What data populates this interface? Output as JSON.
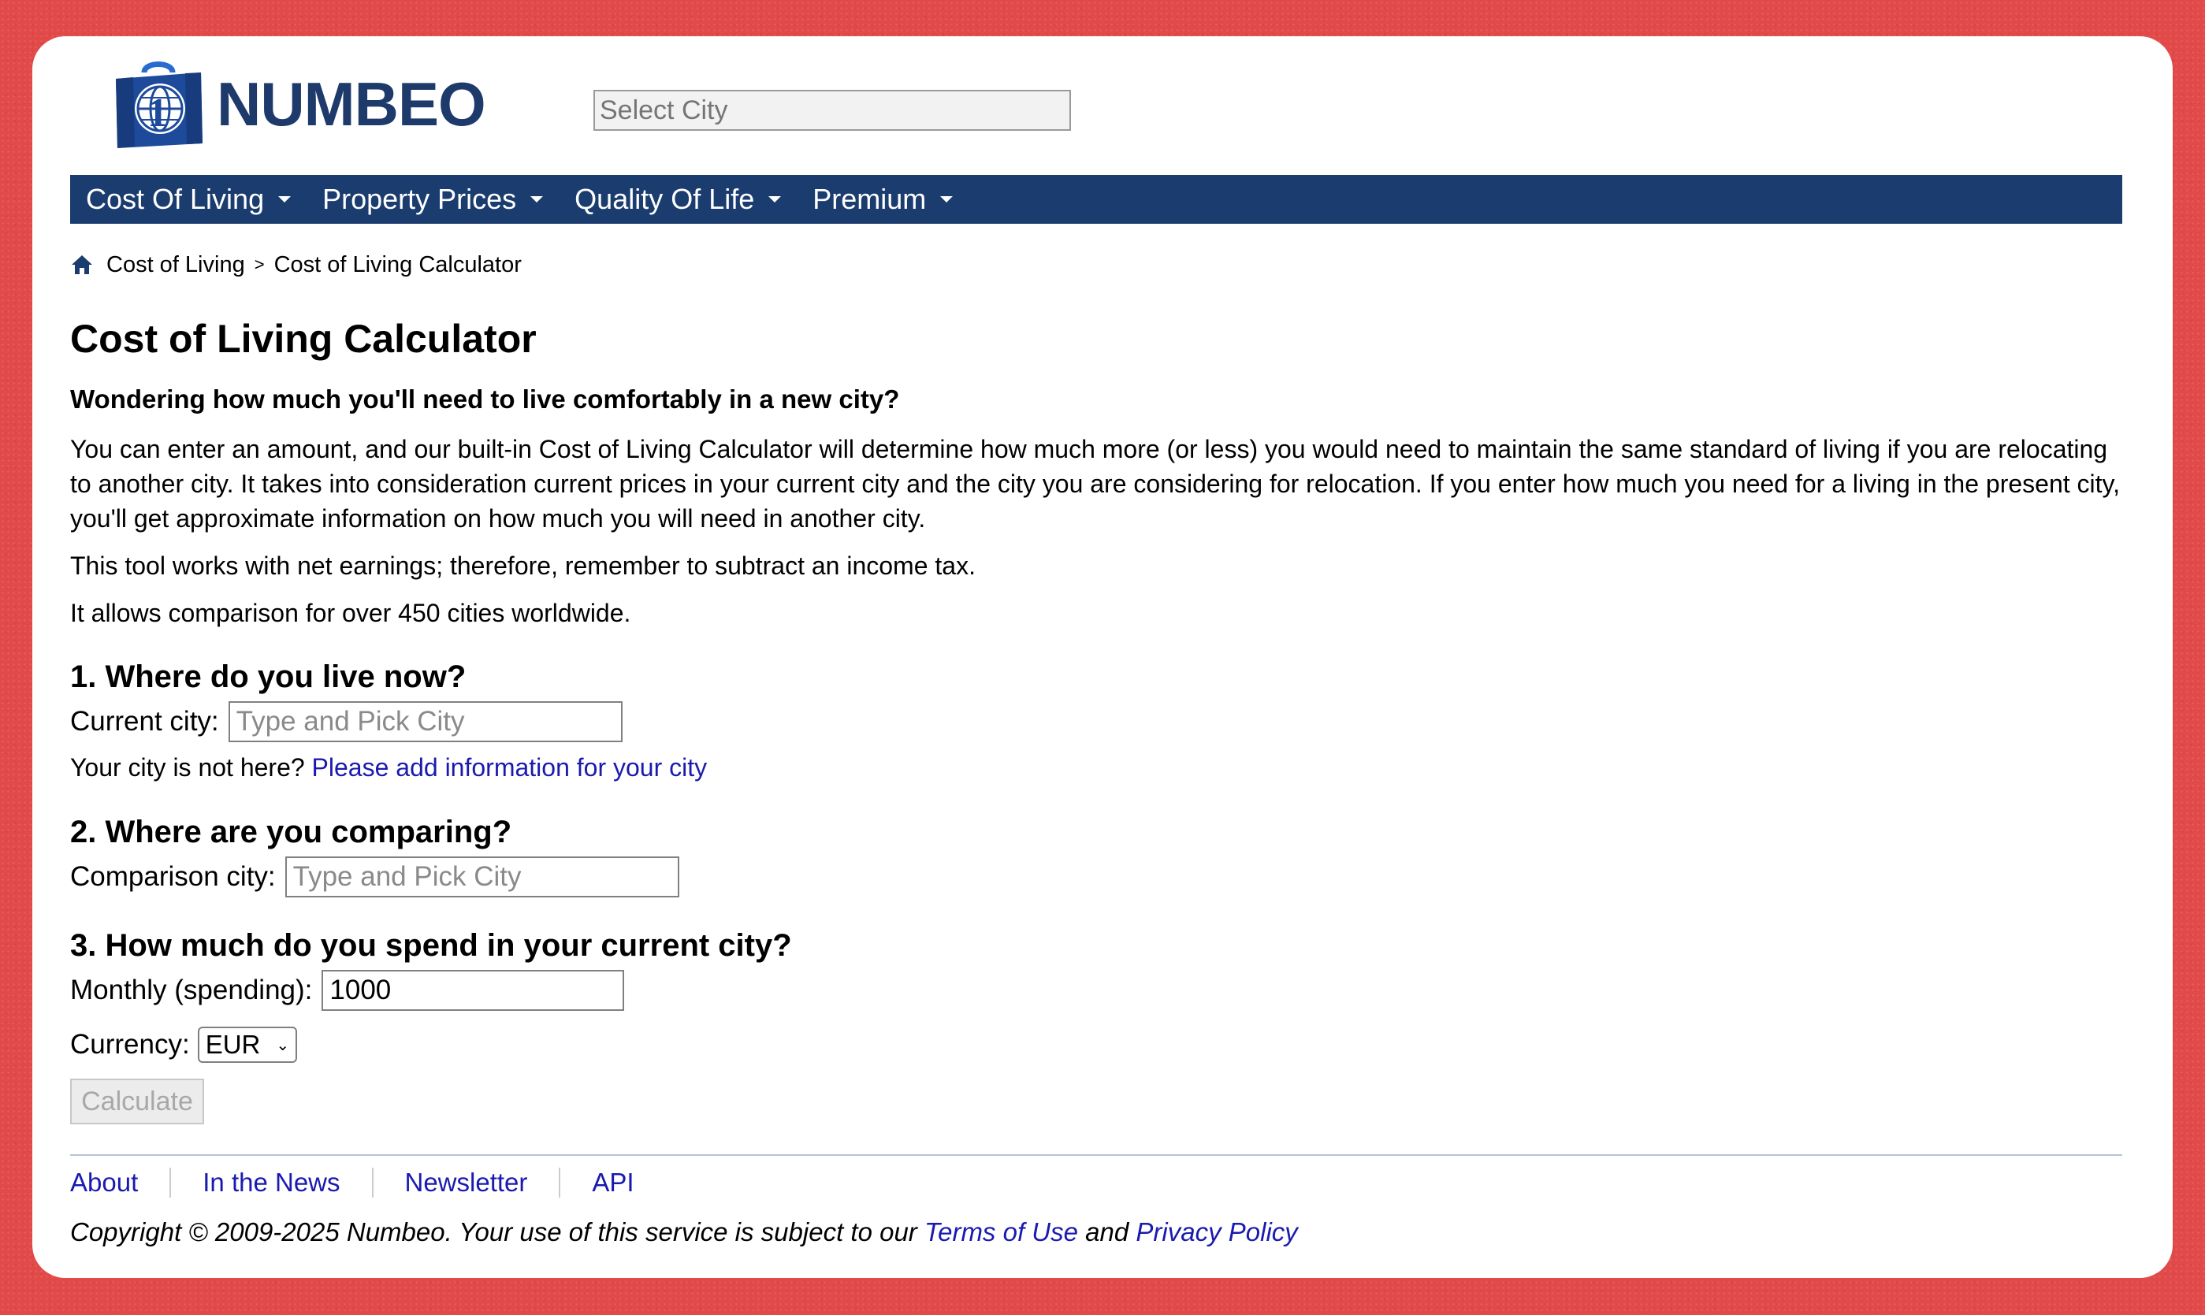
{
  "header": {
    "logo_text": "NUMBEO",
    "logo_icon": "globe-suitcase-icon",
    "search_placeholder": "Select City"
  },
  "nav": {
    "items": [
      {
        "label": "Cost Of Living"
      },
      {
        "label": "Property Prices"
      },
      {
        "label": "Quality Of Life"
      },
      {
        "label": "Premium"
      }
    ]
  },
  "breadcrumb": {
    "items": [
      "Cost of Living",
      "Cost of Living Calculator"
    ],
    "separator": ">"
  },
  "main": {
    "title": "Cost of Living Calculator",
    "lead": "Wondering how much you'll need to live comfortably in a new city?",
    "paragraphs": [
      "You can enter an amount, and our built-in Cost of Living Calculator will determine how much more (or less) you would need to maintain the same standard of living if you are relocating to another city. It takes into consideration current prices in your current city and the city you are considering for relocation. If you enter how much you need for a living in the present city, you'll get approximate information on how much you will need in another city.",
      "This tool works with net earnings; therefore, remember to subtract an income tax.",
      "It allows comparison for over 450 cities worldwide."
    ]
  },
  "form": {
    "step1": {
      "heading": "1. Where do you live now?",
      "label": "Current city:",
      "placeholder": "Type and Pick City",
      "note_text": "Your city is not here?",
      "note_link": "Please add information for your city"
    },
    "step2": {
      "heading": "2. Where are you comparing?",
      "label": "Comparison city:",
      "placeholder": "Type and Pick City"
    },
    "step3": {
      "heading": "3. How much do you spend in your current city?",
      "monthly_label": "Monthly (spending):",
      "monthly_value": "1000",
      "currency_label": "Currency:",
      "currency_value": "EUR"
    },
    "calculate_label": "Calculate"
  },
  "footer": {
    "links": [
      "About",
      "In the News",
      "Newsletter",
      "API"
    ],
    "copyright_prefix": "Copyright © 2009-2025 Numbeo. Your use of this service is subject to our",
    "terms_link": "Terms of Use",
    "and_text": "and",
    "privacy_link": "Privacy Policy"
  },
  "colors": {
    "brand_navy": "#1b3c6e",
    "link": "#1a1ab0",
    "frame_red": "#e24a4a"
  }
}
